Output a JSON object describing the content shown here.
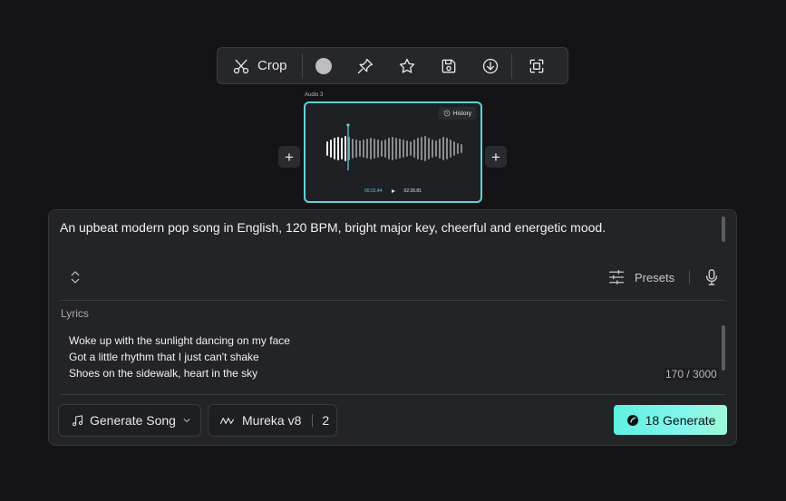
{
  "toolbar": {
    "crop_label": "Crop"
  },
  "audio": {
    "title": "Audio 3",
    "history_label": "History",
    "current_time": "00:22.44",
    "total_time": "02:26.81",
    "accent_color": "#5fd3d3"
  },
  "prompt": {
    "text": "An upbeat modern pop song in English, 120 BPM, bright major key, cheerful and energetic mood.",
    "presets_label": "Presets"
  },
  "lyrics": {
    "label": "Lyrics",
    "lines": [
      "Woke up with the sunlight dancing on my face",
      "Got a little rhythm that I just can't shake",
      "Shoes on the sidewalk, heart in the sky"
    ],
    "counter": "170 / 3000"
  },
  "bottom_bar": {
    "mode_label": "Generate Song",
    "model_label": "Mureka v8",
    "model_count": "2",
    "generate_label": "18 Generate"
  }
}
